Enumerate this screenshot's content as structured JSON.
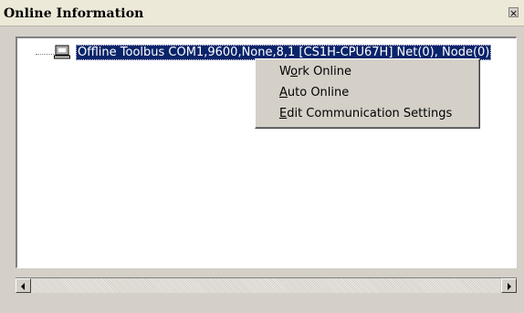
{
  "window": {
    "title": "Online Information",
    "close_glyph": "×"
  },
  "tree": {
    "node_icon": "computer-icon",
    "node_label": "Offline Toolbus COM1,9600,None,8,1 [CS1H-CPU67H] Net(0), Node(0)"
  },
  "context_menu": {
    "items": [
      {
        "pre": "W",
        "mnemonic": "o",
        "post": "rk Online"
      },
      {
        "pre": "",
        "mnemonic": "A",
        "post": "uto Online"
      },
      {
        "pre": "",
        "mnemonic": "E",
        "post": "dit Communication Settings"
      }
    ]
  },
  "colors": {
    "selection": "#0a246a",
    "face": "#d4d0c8"
  }
}
